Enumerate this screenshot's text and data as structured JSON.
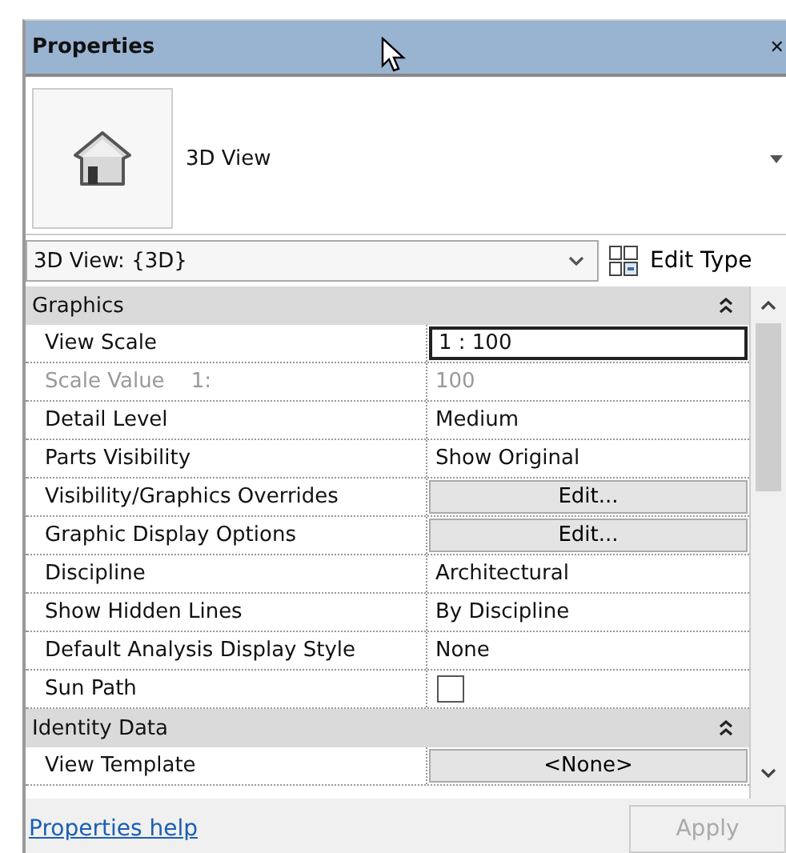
{
  "window": {
    "title": "Properties",
    "close": "✕"
  },
  "type_selector": {
    "name": "3D View"
  },
  "instance_filter": {
    "value": "3D View: {3D}",
    "edit_type": "Edit Type"
  },
  "groups": [
    {
      "name": "Graphics",
      "expanded": true,
      "rows": [
        {
          "label": "View Scale",
          "value": "1 : 100",
          "kind": "input",
          "disabled": false
        },
        {
          "label": "Scale Value    1:",
          "value": "100",
          "kind": "text",
          "disabled": true
        },
        {
          "label": "Detail Level",
          "value": "Medium",
          "kind": "text",
          "disabled": false
        },
        {
          "label": "Parts Visibility",
          "value": "Show Original",
          "kind": "text",
          "disabled": false
        },
        {
          "label": "Visibility/Graphics Overrides",
          "value": "Edit...",
          "kind": "button",
          "disabled": false
        },
        {
          "label": "Graphic Display Options",
          "value": "Edit...",
          "kind": "button",
          "disabled": false
        },
        {
          "label": "Discipline",
          "value": "Architectural",
          "kind": "text",
          "disabled": false
        },
        {
          "label": "Show Hidden Lines",
          "value": "By Discipline",
          "kind": "text",
          "disabled": false
        },
        {
          "label": "Default Analysis Display Style",
          "value": "None",
          "kind": "text",
          "disabled": false
        },
        {
          "label": "Sun Path",
          "kind": "checkbox",
          "checked": false,
          "disabled": false
        }
      ]
    },
    {
      "name": "Identity Data",
      "expanded": true,
      "rows": [
        {
          "label": "View Template",
          "value": "<None>",
          "kind": "button",
          "disabled": false
        }
      ]
    }
  ],
  "footer": {
    "help_link": "Properties help",
    "apply": "Apply",
    "apply_disabled": true
  }
}
